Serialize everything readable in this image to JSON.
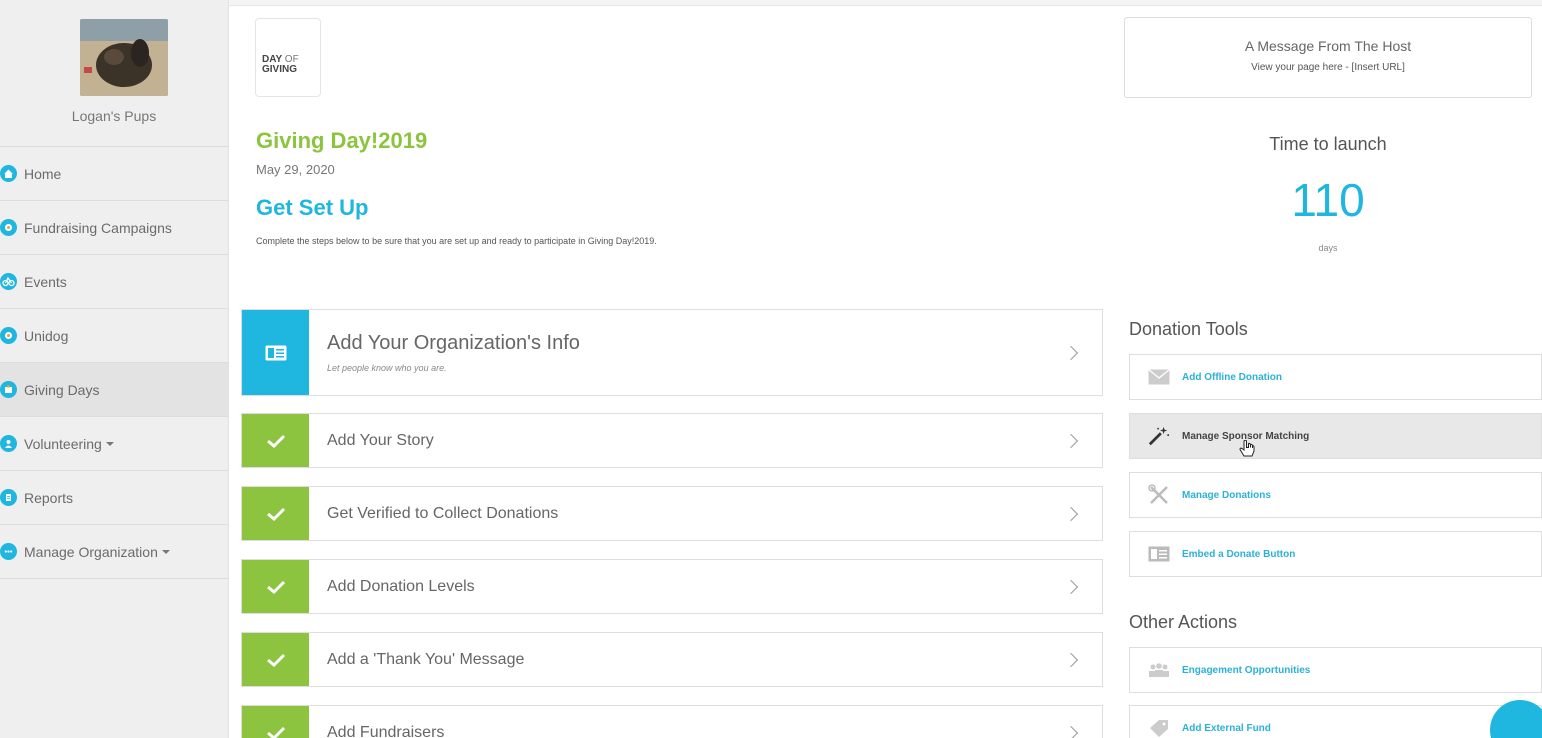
{
  "sidebar": {
    "org_name": "Logan's Pups",
    "items": [
      {
        "label": "Home",
        "icon": "home-icon",
        "color": "#1fb6df"
      },
      {
        "label": "Fundraising Campaigns",
        "icon": "campaign-icon",
        "color": "#1fb6df"
      },
      {
        "label": "Events",
        "icon": "events-icon",
        "color": "#1fb6df"
      },
      {
        "label": "Unidog",
        "icon": "unidog-icon",
        "color": "#1fb6df"
      },
      {
        "label": "Giving Days",
        "icon": "giving-days-icon",
        "color": "#1fb6df"
      },
      {
        "label": "Volunteering",
        "icon": "volunteering-icon",
        "color": "#1fb6df"
      },
      {
        "label": "Reports",
        "icon": "reports-icon",
        "color": "#1fb6df"
      },
      {
        "label": "Manage Organization",
        "icon": "manage-org-icon",
        "color": "#1fb6df"
      }
    ]
  },
  "logo": {
    "day": "DAY",
    "of": "OF",
    "giving": "GIVING"
  },
  "campaign": {
    "title": "Giving Day!2019",
    "date": "May 29, 2020",
    "setup_title": "Get Set Up",
    "setup_desc": "Complete the steps below to be sure that you are set up and ready to participate in Giving Day!2019."
  },
  "steps": [
    {
      "title": "Add Your Organization's Info",
      "subtitle": "Let people know who you are.",
      "status": "incomplete"
    },
    {
      "title": "Add Your Story",
      "status": "complete"
    },
    {
      "title": "Get Verified to Collect Donations",
      "status": "complete"
    },
    {
      "title": "Add Donation Levels",
      "status": "complete"
    },
    {
      "title": "Add a 'Thank You' Message",
      "status": "complete"
    },
    {
      "title": "Add Fundraisers",
      "status": "complete"
    }
  ],
  "host": {
    "title": "A Message From The Host",
    "subtitle": "View your page here - [Insert URL]"
  },
  "launch": {
    "label": "Time to launch",
    "value": "110",
    "unit": "days"
  },
  "donation_tools": {
    "title": "Donation Tools",
    "items": [
      {
        "label": "Add Offline Donation",
        "icon": "envelope-icon"
      },
      {
        "label": "Manage Sponsor Matching",
        "icon": "magic-wand-icon"
      },
      {
        "label": "Manage Donations",
        "icon": "tools-icon"
      },
      {
        "label": "Embed a Donate Button",
        "icon": "embed-icon"
      }
    ]
  },
  "other_actions": {
    "title": "Other Actions",
    "items": [
      {
        "label": "Engagement Opportunities",
        "icon": "people-icon"
      },
      {
        "label": "Add External Fund",
        "icon": "tag-icon"
      }
    ]
  },
  "colors": {
    "green": "#8cc43f",
    "blue": "#1fb6df"
  }
}
